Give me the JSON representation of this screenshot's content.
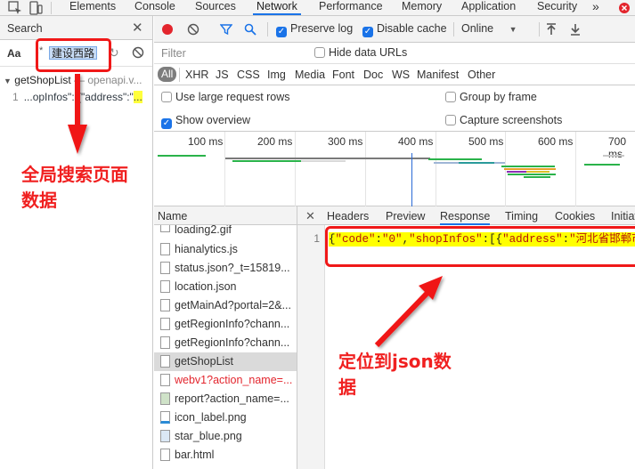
{
  "devtools": {
    "tabs": [
      "Elements",
      "Console",
      "Sources",
      "Network",
      "Performance",
      "Memory",
      "Application",
      "Security"
    ],
    "active_tab": "Network",
    "more_icon": "double-chevron-icon",
    "error_icon": "error-badge-icon"
  },
  "search_panel": {
    "title": "Search",
    "match_case_label": "Aa",
    "regex_label": ".*",
    "query": "建设西路",
    "result_file": "getShopList",
    "result_source": "— openapi.v...",
    "result_line_number": "1",
    "result_snippet_prefix": "...opInfos\":[{\"address\":\"",
    "result_snippet_match": "..."
  },
  "network_toolbar": {
    "preserve_log": "Preserve log",
    "disable_cache": "Disable cache",
    "throttle": "Online",
    "filter_placeholder": "Filter",
    "hide_data_urls": "Hide data URLs",
    "types": [
      "All",
      "XHR",
      "JS",
      "CSS",
      "Img",
      "Media",
      "Font",
      "Doc",
      "WS",
      "Manifest",
      "Other"
    ],
    "options": {
      "large_rows": "Use large request rows",
      "group_by_frame": "Group by frame",
      "show_overview": "Show overview",
      "capture_screenshots": "Capture screenshots"
    }
  },
  "overview": {
    "ticks": [
      "100 ms",
      "200 ms",
      "300 ms",
      "400 ms",
      "500 ms",
      "600 ms",
      "700 ms"
    ]
  },
  "request_list": {
    "header": "Name",
    "items": [
      "loading2.gif",
      "hianalytics.js",
      "status.json?_t=15819...",
      "location.json",
      "getMainAd?portal=2&...",
      "getRegionInfo?chann...",
      "getRegionInfo?chann...",
      "getShopList",
      "webv1?action_name=...",
      "report?action_name=...",
      "icon_label.png",
      "star_blue.png",
      "bar.html"
    ],
    "selected": "getShopList",
    "error_item": "webv1?action_name=..."
  },
  "response_panel": {
    "tabs": [
      "Headers",
      "Preview",
      "Response",
      "Timing",
      "Cookies",
      "Initiat"
    ],
    "active_tab": "Response",
    "line_number": "1",
    "code_tokens": [
      "{",
      "\"code\"",
      ":",
      "\"0\"",
      ",",
      "\"shopInfos\"",
      ":[{",
      "\"address\"",
      ":",
      "\"河北省邯郸市邯"
    ]
  },
  "annotations": {
    "left_note_line1": "全局搜索页面",
    "left_note_line2": "数据",
    "right_note_line1": "定位到json数",
    "right_note_line2": "据"
  },
  "colors": {
    "annotation_red": "#f01818",
    "accent_blue": "#1a73e8",
    "highlight_yellow": "#ffff00"
  }
}
